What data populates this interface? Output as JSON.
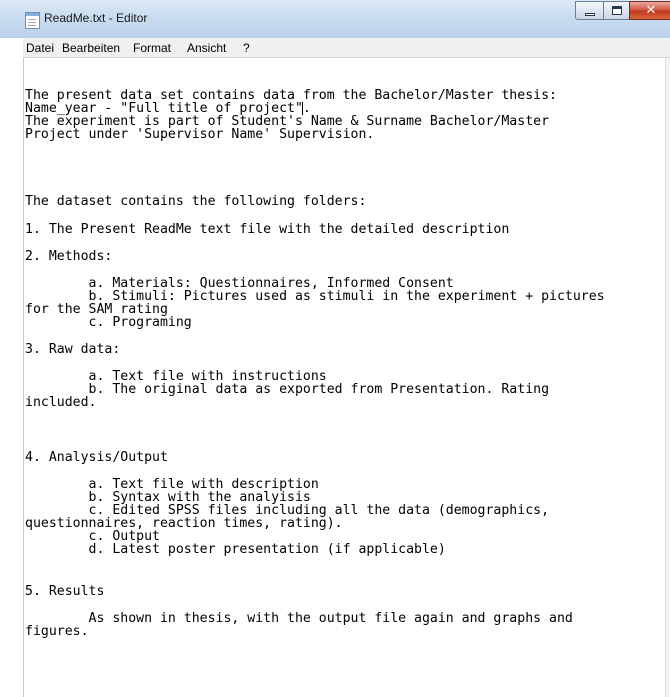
{
  "window": {
    "title": "ReadMe.txt - Editor"
  },
  "menu": [
    "Datei",
    "Bearbeiten",
    "Format",
    "Ansicht",
    "?"
  ],
  "icons": {
    "app": "notepad-icon",
    "minimize": "minimize-icon",
    "maximize": "maximize-icon",
    "close": "close-icon"
  },
  "editor": {
    "lines": [
      "The present data set contains data from the Bachelor/Master thesis:",
      "Name_year - \"Full title of project\".",
      "The experiment is part of Student's Name & Surname Bachelor/Master",
      "Project under 'Supervisor Name' Supervision.",
      "The dataset contains the following folders:",
      "1. The Present ReadMe text file with the detailed description",
      "2. Methods:",
      "        a. Materials: Questionnaires, Informed Consent",
      "        b. Stimuli: Pictures used as stimuli in the experiment + pictures",
      "for the SAM rating",
      "        c. Programing",
      "3. Raw data:",
      "        a. Text file with instructions",
      "        b. The original data as exported from Presentation. Rating",
      "included.",
      "4. Analysis/Output",
      "        a. Text file with description",
      "        b. Syntax with the analyisis",
      "        c. Edited SPSS files including all the data (demographics,",
      "questionnaires, reaction times, rating).",
      "        c. Output",
      "        d. Latest poster presentation (if applicable)",
      "5. Results",
      "        As shown in thesis, with the output file again and graphs and",
      "figures."
    ]
  }
}
